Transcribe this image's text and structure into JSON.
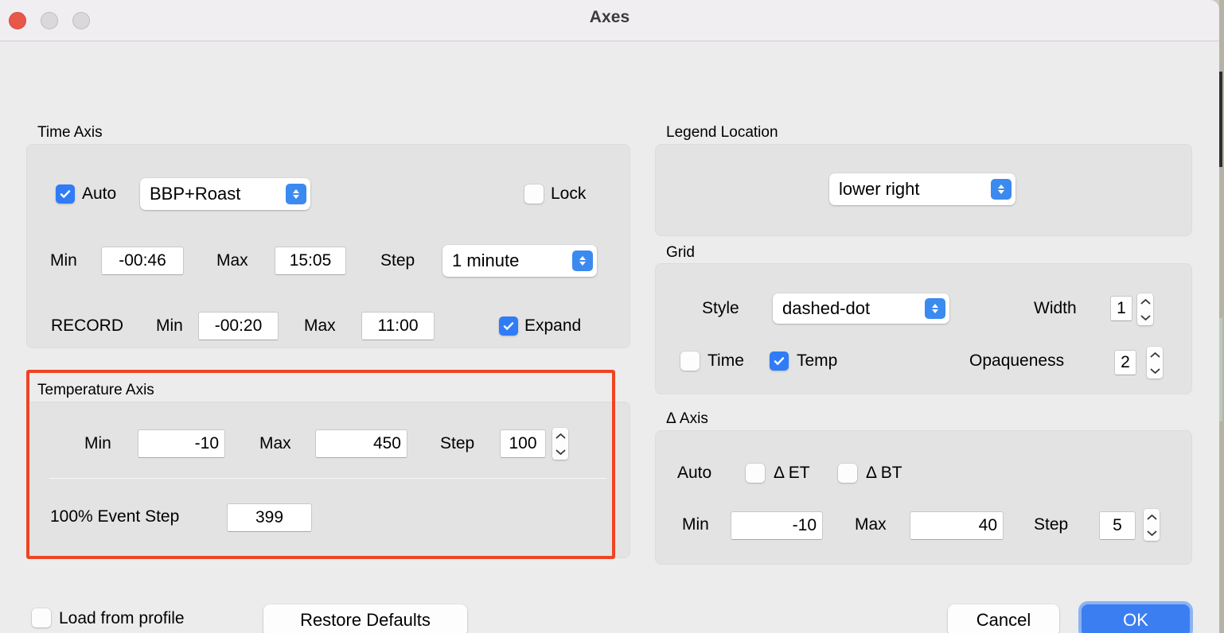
{
  "window": {
    "title": "Axes",
    "traffic_lights": [
      "close-button",
      "minimize-button",
      "zoom-button"
    ]
  },
  "time_axis": {
    "group_label": "Time Axis",
    "auto_label": "Auto",
    "auto_checked": true,
    "mode_value": "BBP+Roast",
    "lock_label": "Lock",
    "lock_checked": false,
    "min_label": "Min",
    "min_value": "-00:46",
    "max_label": "Max",
    "max_value": "15:05",
    "step_label": "Step",
    "step_value": "1 minute",
    "record_label": "RECORD",
    "record_min_label": "Min",
    "record_min_value": "-00:20",
    "record_max_label": "Max",
    "record_max_value": "11:00",
    "expand_label": "Expand",
    "expand_checked": true
  },
  "temperature_axis": {
    "group_label": "Temperature Axis",
    "min_label": "Min",
    "min_value": "-10",
    "max_label": "Max",
    "max_value": "450",
    "step_label": "Step",
    "step_value": "100",
    "event_step_label": "100% Event Step",
    "event_step_value": "399",
    "highlight_color": "#ef4423"
  },
  "legend": {
    "group_label": "Legend Location",
    "location_value": "lower right"
  },
  "grid": {
    "group_label": "Grid",
    "style_label": "Style",
    "style_value": "dashed-dot",
    "width_label": "Width",
    "width_value": "1",
    "time_label": "Time",
    "time_checked": false,
    "temp_label": "Temp",
    "temp_checked": true,
    "opaqueness_label": "Opaqueness",
    "opaqueness_value": "2"
  },
  "delta_axis": {
    "group_label": "Δ  Axis",
    "auto_label": "Auto",
    "delta_et_label": "Δ ET",
    "delta_et_checked": false,
    "delta_bt_label": "Δ BT",
    "delta_bt_checked": false,
    "min_label": "Min",
    "min_value": "-10",
    "max_label": "Max",
    "max_value": "40",
    "step_label": "Step",
    "step_value": "5"
  },
  "footer": {
    "load_from_profile_label": "Load from profile",
    "load_from_profile_checked": false,
    "restore_defaults_label": "Restore Defaults",
    "cancel_label": "Cancel",
    "ok_label": "OK",
    "accent_color": "#3b7ef2"
  }
}
